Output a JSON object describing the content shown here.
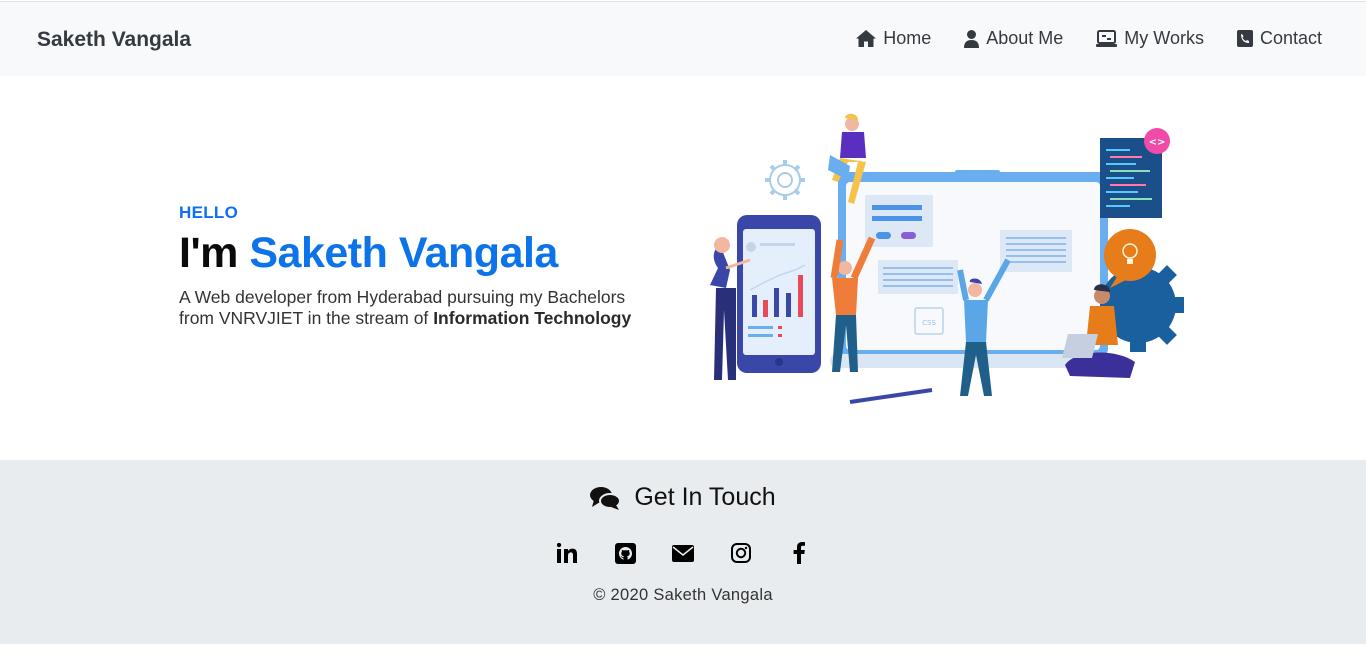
{
  "navbar": {
    "brand": "Saketh Vangala",
    "items": [
      {
        "label": "Home",
        "icon": "home-icon"
      },
      {
        "label": "About Me",
        "icon": "user-icon"
      },
      {
        "label": "My Works",
        "icon": "laptop-icon"
      },
      {
        "label": "Contact",
        "icon": "phone-icon"
      }
    ]
  },
  "hero": {
    "greeting": "HELLO",
    "headline_prefix": "I'm",
    "headline_name": "Saketh Vangala",
    "description": "A Web developer from Hyderabad pursuing my Bachelors from VNRVJIET in the stream of",
    "description_bold": "Information Technology",
    "illustration_badge": "<>",
    "illustration_css_tag": "CSS"
  },
  "footer": {
    "title": "Get In Touch",
    "title_icon": "comments-icon",
    "socials": [
      {
        "icon": "linkedin-icon"
      },
      {
        "icon": "github-icon"
      },
      {
        "icon": "envelope-icon"
      },
      {
        "icon": "instagram-icon"
      },
      {
        "icon": "facebook-icon"
      }
    ],
    "copyright": "© 2020 Saketh Vangala"
  },
  "colors": {
    "accent": "#0d73e8",
    "navbar_bg": "#f8f9fa",
    "footer_bg": "#e9ecef"
  }
}
